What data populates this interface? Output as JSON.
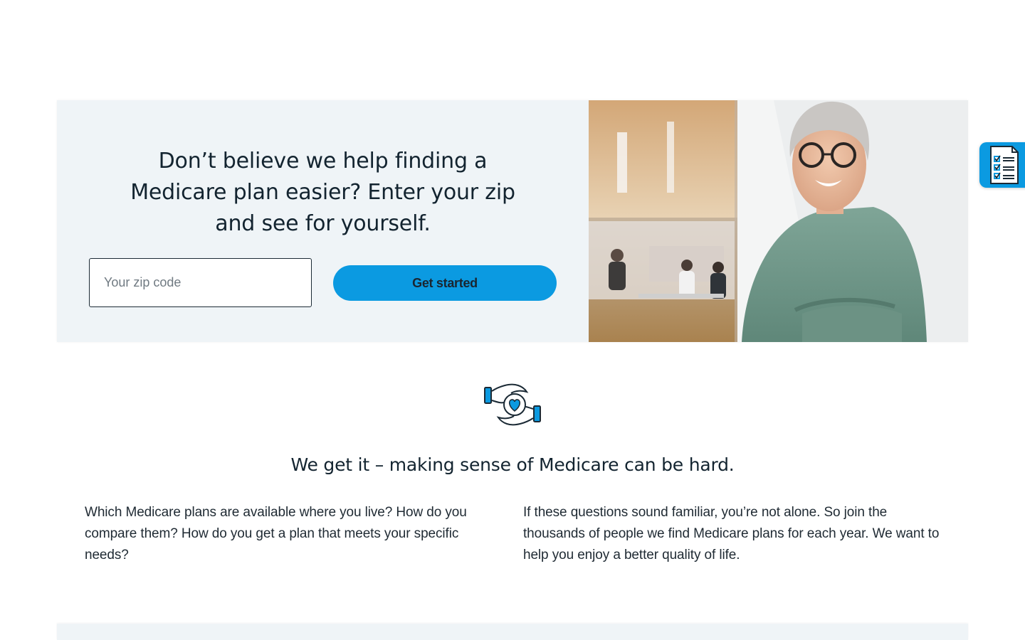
{
  "hero": {
    "title": "Don’t believe we help finding a Medicare plan easier? Enter your zip and see for yourself.",
    "zip_placeholder": "Your zip code",
    "cta_label": "Get started",
    "photo": "smiling-woman-glasses-office-photo"
  },
  "side_tab": {
    "icon": "checklist-icon"
  },
  "empathy": {
    "icon": "hands-heart-icon",
    "heading": "We get it – making sense of Medicare can be hard.",
    "left_paragraph": "Which Medicare plans are available where you live? How do you compare them? How do you get a plan that meets your specific needs?",
    "right_paragraph": "If these questions sound familiar, you’re not alone. So join the thousands of people we find Medicare plans for each year. We want to help you enjoy a better quality of life."
  },
  "colors": {
    "accent": "#0b9ae1",
    "panel_bg": "#eff4f7",
    "heading_text": "#132430"
  }
}
